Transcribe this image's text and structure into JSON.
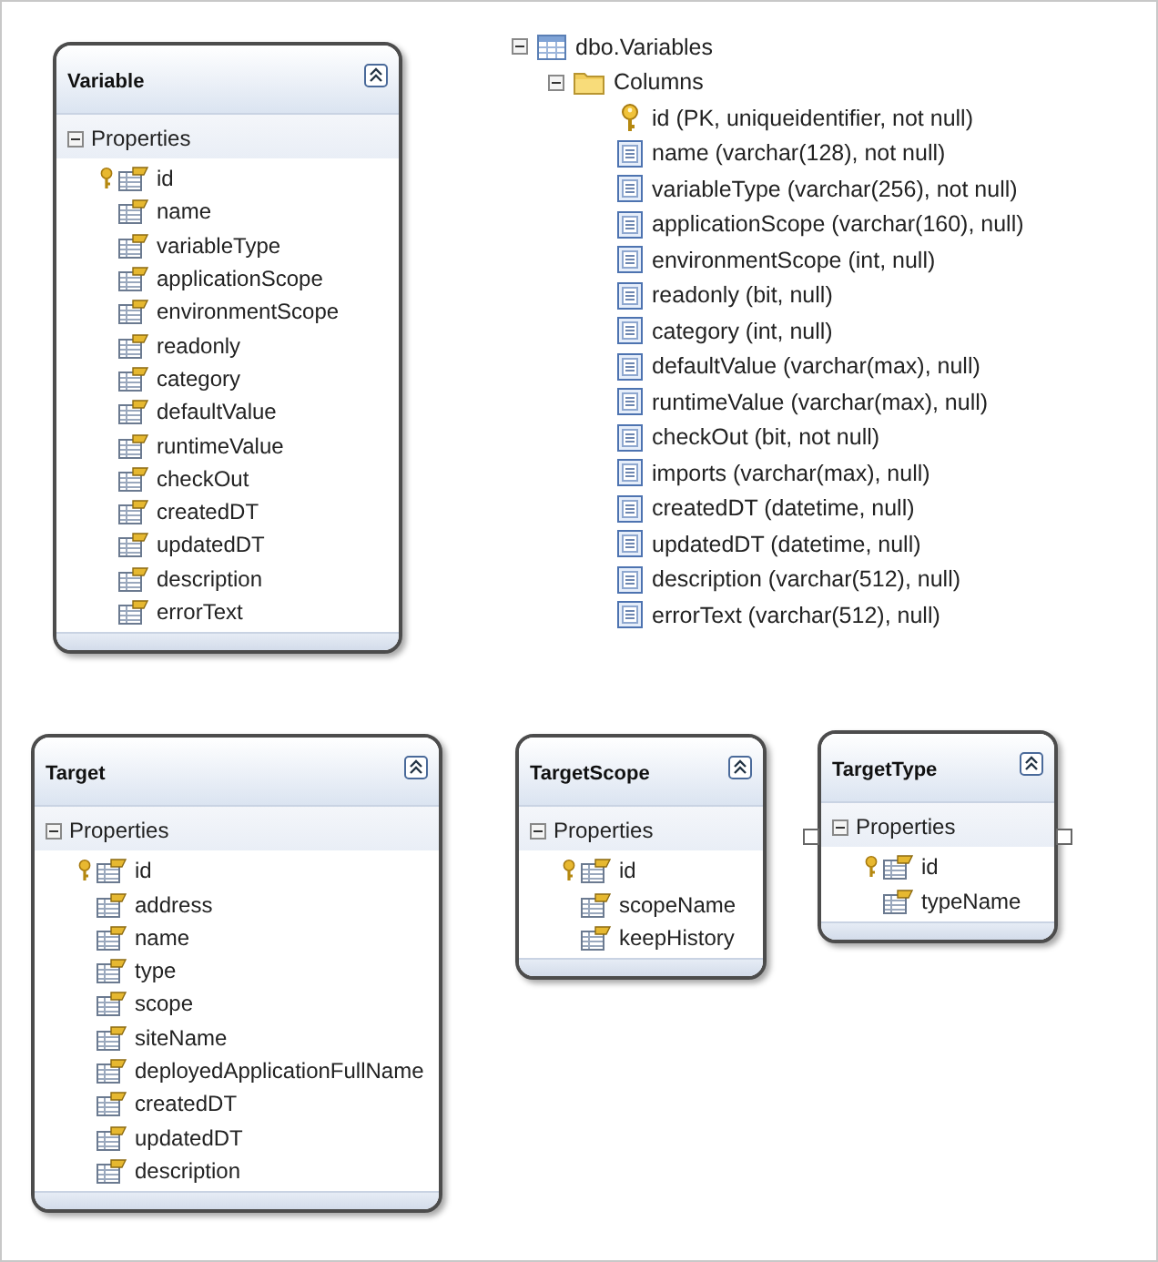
{
  "entities": [
    {
      "title": "Variable",
      "selected": false,
      "section": {
        "label": "Properties",
        "expanded": true
      },
      "properties": [
        {
          "name": "id",
          "key": true
        },
        {
          "name": "name",
          "key": false
        },
        {
          "name": "variableType",
          "key": false
        },
        {
          "name": "applicationScope",
          "key": false
        },
        {
          "name": "environmentScope",
          "key": false
        },
        {
          "name": "readonly",
          "key": false
        },
        {
          "name": "category",
          "key": false
        },
        {
          "name": "defaultValue",
          "key": false
        },
        {
          "name": "runtimeValue",
          "key": false
        },
        {
          "name": "checkOut",
          "key": false
        },
        {
          "name": "createdDT",
          "key": false
        },
        {
          "name": "updatedDT",
          "key": false
        },
        {
          "name": "description",
          "key": false
        },
        {
          "name": "errorText",
          "key": false
        }
      ]
    },
    {
      "title": "Target",
      "selected": false,
      "section": {
        "label": "Properties",
        "expanded": true
      },
      "properties": [
        {
          "name": "id",
          "key": true
        },
        {
          "name": "address",
          "key": false
        },
        {
          "name": "name",
          "key": false
        },
        {
          "name": "type",
          "key": false
        },
        {
          "name": "scope",
          "key": false
        },
        {
          "name": "siteName",
          "key": false
        },
        {
          "name": "deployedApplicationFullName",
          "key": false
        },
        {
          "name": "createdDT",
          "key": false
        },
        {
          "name": "updatedDT",
          "key": false
        },
        {
          "name": "description",
          "key": false
        }
      ]
    },
    {
      "title": "TargetScope",
      "selected": false,
      "section": {
        "label": "Properties",
        "expanded": true
      },
      "properties": [
        {
          "name": "id",
          "key": true
        },
        {
          "name": "scopeName",
          "key": false
        },
        {
          "name": "keepHistory",
          "key": false
        }
      ]
    },
    {
      "title": "TargetType",
      "selected": true,
      "section": {
        "label": "Properties",
        "expanded": true
      },
      "properties": [
        {
          "name": "id",
          "key": true
        },
        {
          "name": "typeName",
          "key": false
        }
      ]
    }
  ],
  "tree": {
    "label": "dbo.Variables",
    "expanded": true,
    "children": [
      {
        "label": "Columns",
        "expanded": true,
        "children": [
          {
            "label": "id (PK, uniqueidentifier, not null)",
            "kind": "key"
          },
          {
            "label": "name (varchar(128), not null)",
            "kind": "column"
          },
          {
            "label": "variableType (varchar(256), not null)",
            "kind": "column"
          },
          {
            "label": "applicationScope (varchar(160), null)",
            "kind": "column"
          },
          {
            "label": "environmentScope (int, null)",
            "kind": "column"
          },
          {
            "label": "readonly (bit, null)",
            "kind": "column"
          },
          {
            "label": "category (int, null)",
            "kind": "column"
          },
          {
            "label": "defaultValue (varchar(max), null)",
            "kind": "column"
          },
          {
            "label": "runtimeValue (varchar(max), null)",
            "kind": "column"
          },
          {
            "label": "checkOut (bit, not null)",
            "kind": "column"
          },
          {
            "label": "imports (varchar(max), null)",
            "kind": "column"
          },
          {
            "label": "createdDT (datetime, null)",
            "kind": "column"
          },
          {
            "label": "updatedDT (datetime, null)",
            "kind": "column"
          },
          {
            "label": "description (varchar(512), null)",
            "kind": "column"
          },
          {
            "label": "errorText (varchar(512), null)",
            "kind": "column"
          }
        ]
      }
    ]
  }
}
